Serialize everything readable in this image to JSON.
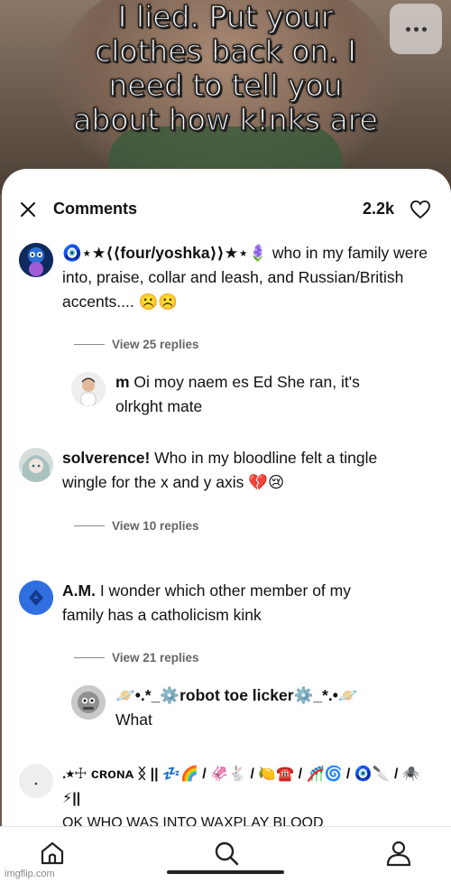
{
  "video": {
    "caption_lines": [
      "I lied. Put your",
      "clothes back on. I",
      "need to tell you",
      "about how k!nks are"
    ]
  },
  "comments_sheet": {
    "title": "Comments",
    "count": "2.2k",
    "comments": [
      {
        "username": "🧿⋆★⟨⟨four/yoshka⟩⟩★⋆🪻",
        "text": " who in my family were into, praise, collar and leash, and Russian/British accents.... ☹️☹️",
        "replies_label": "View 25 replies",
        "reply": {
          "username": "m",
          "text": " Oi moy naem es Ed She ran, it's olrkght mate"
        }
      },
      {
        "username": "solverence!",
        "text": " Who in my bloodline felt a tingle wingle for the x and y axis 💔😢",
        "replies_label": "View 10 replies"
      },
      {
        "username": "A.M.",
        "text": " I wonder which other member of my family has a catholicism kink",
        "replies_label": "View 21 replies",
        "reply": {
          "username": "🪐•.*_⚙️robot toe licker⚙️_*.•🪐",
          "text": "What"
        }
      },
      {
        "username": ".⭒☩ ᴄʀᴏɴᴀ ᛝ || 💤🌈  / 🦑🐇 / 🍋☎️ / 🎢🌀 / 🧿🔪 / 🕷️⚡||",
        "text": "OK WHO WAS INTO WAXPLAY BLOOD"
      }
    ]
  },
  "nav": {
    "items": [
      "home-icon",
      "search-icon",
      "profile-icon"
    ]
  },
  "watermark": "imgflip.com"
}
